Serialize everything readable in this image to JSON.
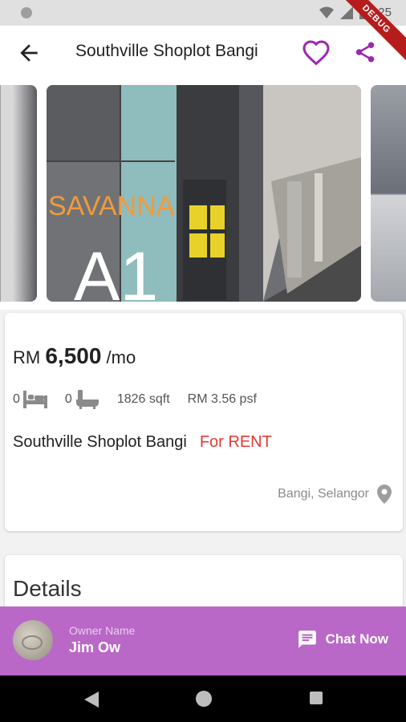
{
  "status_bar": {
    "time": "8:25",
    "debug_label": "DEBUG"
  },
  "app_bar": {
    "title": "Southville Shoplot Bangi",
    "colors": {
      "accent": "#9c27b0"
    }
  },
  "gallery": {
    "images": [
      {
        "name": "photo-prev"
      },
      {
        "name": "photo-main",
        "sign_text": "SAVANNA",
        "unit_label": "A1"
      },
      {
        "name": "photo-next"
      }
    ]
  },
  "listing": {
    "currency": "RM",
    "price": "6,500",
    "period": "/mo",
    "bedrooms": "0",
    "bathrooms": "0",
    "area": "1826 sqft",
    "price_per_sqft": "RM 3.56 psf",
    "name": "Southville Shoplot Bangi",
    "type": "For RENT",
    "location": "Bangi, Selangor",
    "colors": {
      "type": "#e53935"
    }
  },
  "details": {
    "title": "Details"
  },
  "owner": {
    "label": "Owner Name",
    "name": "Jim Ow",
    "chat_label": "Chat Now",
    "colors": {
      "bar": "#b968c7"
    }
  }
}
